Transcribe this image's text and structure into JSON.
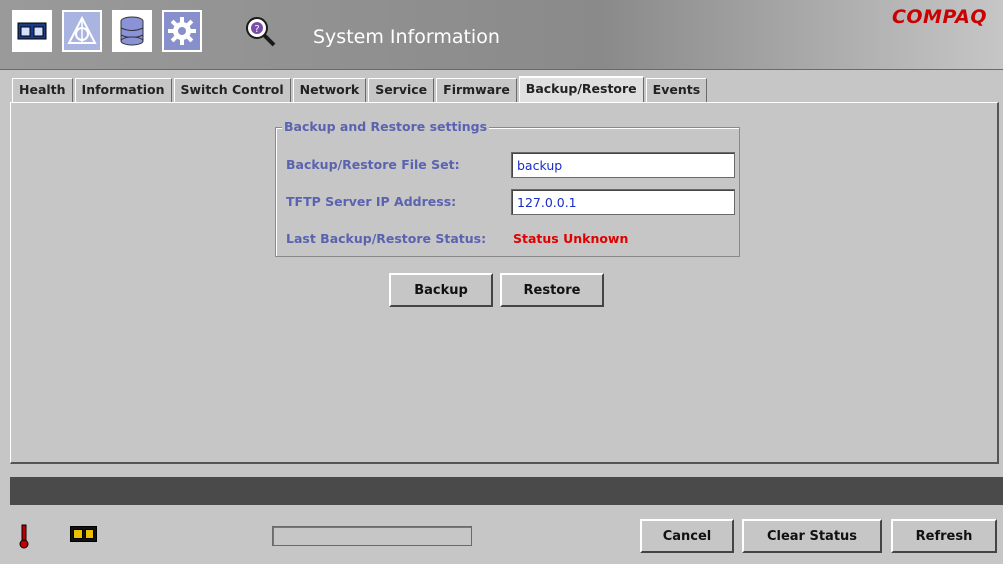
{
  "header": {
    "title": "System Information",
    "brand": "COMPAQ",
    "toolbar_icons": [
      "switch-icon",
      "network-triangle-icon",
      "database-icon",
      "gear-icon",
      "magnifier-help-icon"
    ]
  },
  "tabs": [
    {
      "label": "Health",
      "active": false
    },
    {
      "label": "Information",
      "active": false
    },
    {
      "label": "Switch Control",
      "active": false
    },
    {
      "label": "Network",
      "active": false
    },
    {
      "label": "Service",
      "active": false
    },
    {
      "label": "Firmware",
      "active": false
    },
    {
      "label": "Backup/Restore",
      "active": true
    },
    {
      "label": "Events",
      "active": false
    }
  ],
  "backup": {
    "group_title": "Backup and Restore settings",
    "fileset_label": "Backup/Restore File Set:",
    "fileset_value": "backup",
    "tftp_label": "TFTP Server IP Address:",
    "tftp_value": "127.0.0.1",
    "status_label": "Last Backup/Restore Status:",
    "status_value": "Status Unknown",
    "status_color": "#e00000",
    "backup_button": "Backup",
    "restore_button": "Restore"
  },
  "footer": {
    "progress": 0,
    "cancel_button": "Cancel",
    "clear_status_button": "Clear Status",
    "refresh_button": "Refresh"
  },
  "colors": {
    "label": "#5a63b0",
    "input_text": "#1a2cc8",
    "brand": "#cc0000"
  }
}
